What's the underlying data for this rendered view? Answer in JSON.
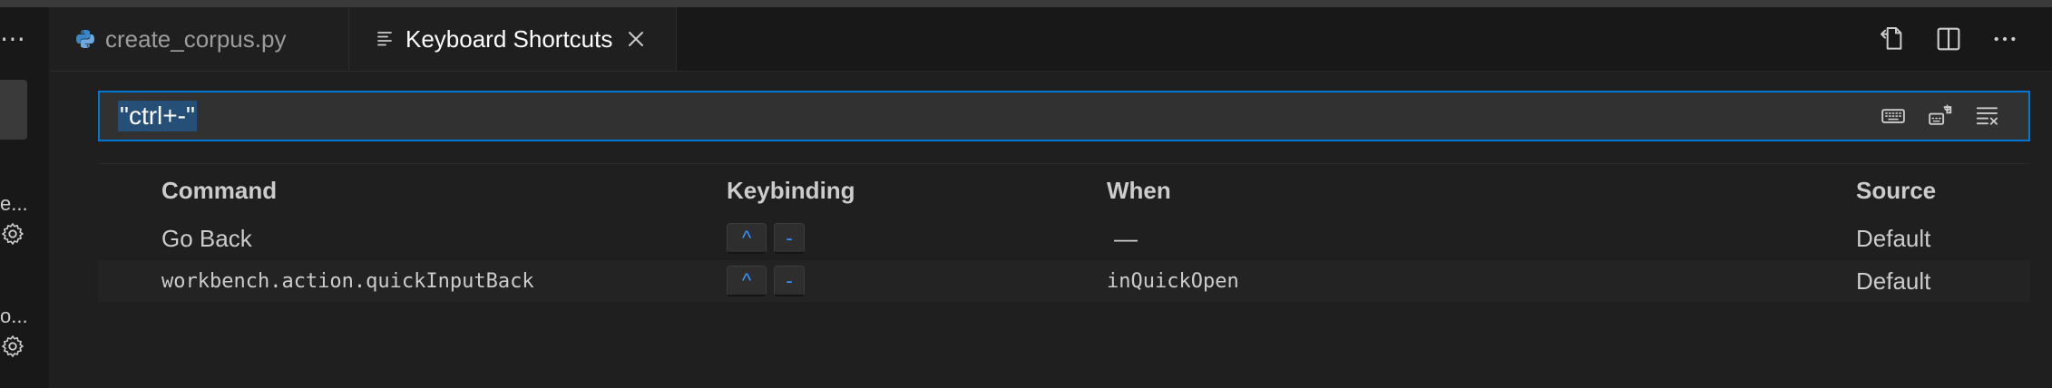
{
  "tabs": [
    {
      "label": "create_corpus.py",
      "icon": "python-icon",
      "active": false
    },
    {
      "label": "Keyboard Shortcuts",
      "icon": "keyboard-shortcuts-icon",
      "active": true
    }
  ],
  "sidebar": {
    "more_label": "⋯",
    "items": [
      {
        "label": "e..."
      },
      {
        "label": "o..."
      }
    ]
  },
  "search": {
    "value": "\"ctrl+-\"",
    "icons": [
      "record-keys-icon",
      "sort-by-precedence-icon",
      "clear-input-icon"
    ]
  },
  "editor_actions": [
    "open-keybindings-json-icon",
    "split-editor-icon",
    "more-actions-icon"
  ],
  "table": {
    "headers": {
      "command": "Command",
      "keybinding": "Keybinding",
      "when": "When",
      "source": "Source"
    },
    "rows": [
      {
        "command": "Go Back",
        "keys": [
          "^",
          "-"
        ],
        "when": "—",
        "source": "Default"
      },
      {
        "command": "workbench.action.quickInputBack",
        "keys": [
          "^",
          "-"
        ],
        "when": "inQuickOpen",
        "source": "Default"
      }
    ]
  },
  "colors": {
    "accent": "#0078d4",
    "key_text": "#3794ff",
    "selection": "#264f78",
    "background": "#1f1f1f"
  }
}
